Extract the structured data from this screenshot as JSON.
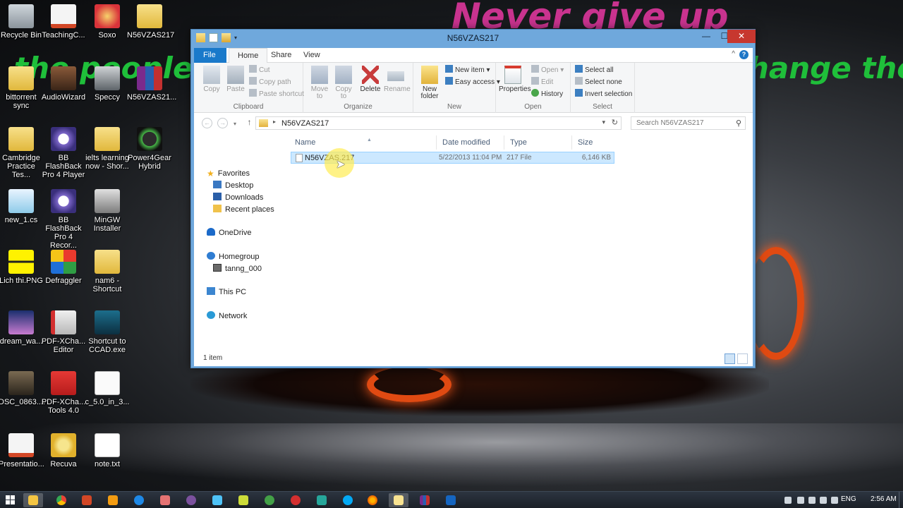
{
  "wallpaper": {
    "line1": "Never give up",
    "line2": "the people w",
    "line3": "hange the"
  },
  "desktop_icons": [
    {
      "label": "Recycle Bin",
      "icon": "recycle-bin-icon"
    },
    {
      "label": "TeachingC...",
      "icon": "powerpoint-file-icon"
    },
    {
      "label": "Soxo",
      "icon": "game-icon"
    },
    {
      "label": "N56VZAS217",
      "icon": "folder-icon"
    },
    {
      "label": "bittorrent sync",
      "icon": "folder-icon"
    },
    {
      "label": "AudioWizard",
      "icon": "audio-wizard-icon"
    },
    {
      "label": "Speccy",
      "icon": "speccy-icon"
    },
    {
      "label": "N56VZAS21...",
      "icon": "winrar-archive-icon"
    },
    {
      "label": "Cambridge Practice Tes...",
      "icon": "folder-icon"
    },
    {
      "label": "BB FlashBack Pro 4 Player",
      "icon": "flashback-player-icon"
    },
    {
      "label": "ielts learning now - Shor...",
      "icon": "folder-shortcut-icon"
    },
    {
      "label": "Power4Gear Hybrid",
      "icon": "power4gear-icon"
    },
    {
      "label": "new_1.cs",
      "icon": "cs-file-icon"
    },
    {
      "label": "BB FlashBack Pro 4 Recor...",
      "icon": "flashback-recorder-icon"
    },
    {
      "label": "MinGW Installer",
      "icon": "mingw-installer-icon"
    },
    {
      "label": "Lich thi.PNG",
      "icon": "png-image-icon"
    },
    {
      "label": "Defraggler",
      "icon": "defraggler-icon"
    },
    {
      "label": "nam6 - Shortcut",
      "icon": "folder-shortcut-icon"
    },
    {
      "label": "dream_wa...",
      "icon": "image-file-icon"
    },
    {
      "label": "PDF-XCha... Editor",
      "icon": "pdf-xchange-editor-icon"
    },
    {
      "label": "Shortcut to CCAD.exe",
      "icon": "ccad-shortcut-icon"
    },
    {
      "label": "DSC_0863....",
      "icon": "photo-file-icon"
    },
    {
      "label": "PDF-XCha... Tools 4.0",
      "icon": "pdf-xchange-tools-icon"
    },
    {
      "label": "c_5.0_in_3...",
      "icon": "document-file-icon"
    },
    {
      "label": "Presentatio...",
      "icon": "powerpoint-file-icon"
    },
    {
      "label": "Recuva",
      "icon": "recuva-icon"
    },
    {
      "label": "note.txt",
      "icon": "text-file-icon"
    }
  ],
  "window": {
    "title": "N56VZAS217",
    "minimize_glyph": "—",
    "maximize_glyph": "☐",
    "close_glyph": "✕"
  },
  "ribbon": {
    "tabs": [
      "File",
      "Home",
      "Share",
      "View"
    ],
    "active_tab": "Home",
    "expand_glyph": "^",
    "help_glyph": "?",
    "groups": {
      "clipboard": {
        "label": "Clipboard",
        "copy": "Copy",
        "paste": "Paste",
        "cut": "Cut",
        "copy_path": "Copy path",
        "paste_shortcut": "Paste shortcut"
      },
      "organize": {
        "label": "Organize",
        "move_to": "Move to",
        "copy_to": "Copy to",
        "delete": "Delete",
        "rename": "Rename"
      },
      "new": {
        "label": "New",
        "new_folder": "New folder",
        "new_item": "New item",
        "easy_access": "Easy access"
      },
      "open": {
        "label": "Open",
        "properties": "Properties",
        "open": "Open",
        "edit": "Edit",
        "history": "History"
      },
      "select": {
        "label": "Select",
        "select_all": "Select all",
        "select_none": "Select none",
        "invert_selection": "Invert selection"
      }
    }
  },
  "address": {
    "path": "N56VZAS217",
    "search_placeholder": "Search N56VZAS217"
  },
  "nav_pane": {
    "favorites": "Favorites",
    "desktop": "Desktop",
    "downloads": "Downloads",
    "recent_places": "Recent places",
    "onedrive": "OneDrive",
    "homegroup": "Homegroup",
    "user": "tanng_000",
    "this_pc": "This PC",
    "network": "Network"
  },
  "file_list": {
    "columns": [
      "Name",
      "Date modified",
      "Type",
      "Size"
    ],
    "rows": [
      {
        "name": "N56VZAS.217",
        "date_modified": "5/22/2013 11:04 PM",
        "type": "217 File",
        "size": "6,146 KB"
      }
    ]
  },
  "status": {
    "item_count": "1 item"
  },
  "taskbar": {
    "pinned": [
      "file-explorer-icon",
      "chrome-icon",
      "powerpoint-icon",
      "vlc-icon",
      "ie-icon",
      "app-icon",
      "viber-icon",
      "notepad-icon",
      "xbox-icon",
      "opera-icon",
      "internet-download-icon",
      "skype-icon",
      "firefox-icon",
      "folder-icon",
      "winrar-icon",
      "teamviewer-icon"
    ],
    "language": "ENG",
    "clock": "2:56 AM"
  }
}
